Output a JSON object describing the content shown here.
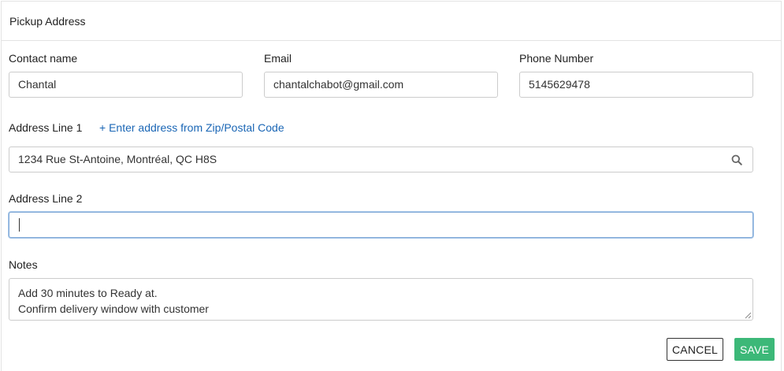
{
  "panel": {
    "title": "Pickup Address"
  },
  "contact": {
    "name_label": "Contact name",
    "name_value": "Chantal",
    "email_label": "Email",
    "email_value": "chantalchabot@gmail.com",
    "phone_label": "Phone Number",
    "phone_value": "5145629478"
  },
  "address": {
    "line1_label": "Address Line 1",
    "zip_link": "+ Enter address from Zip/Postal Code",
    "line1_value": "1234 Rue St-Antoine, Montréal, QC H8S",
    "search_icon": "search-icon",
    "line2_label": "Address Line 2",
    "line2_value": ""
  },
  "notes": {
    "label": "Notes",
    "lines": [
      "Add 30 minutes to Ready at.",
      "Confirm delivery window with customer"
    ]
  },
  "actions": {
    "cancel_label": "CANCEL",
    "save_label": "SAVE"
  },
  "colors": {
    "link": "#1a66b5",
    "save_button": "#3cb878",
    "focus_border": "#7fa8d6"
  }
}
